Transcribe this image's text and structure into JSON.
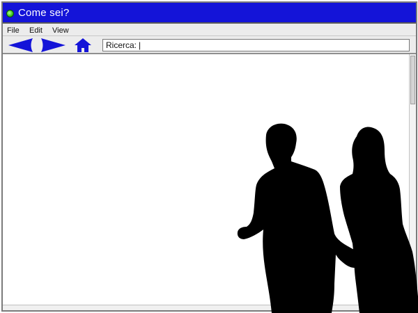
{
  "window": {
    "title": "Come sei?"
  },
  "menu": {
    "items": [
      "File",
      "Edit",
      "View"
    ]
  },
  "toolbar": {
    "back_icon": "left-arrow-icon",
    "forward_icon": "right-arrow-icon",
    "home_icon": "house-icon",
    "icon_color": "#1414d8"
  },
  "search": {
    "label": "Ricerca:",
    "value": ""
  },
  "colors": {
    "titlebar": "#1414d8",
    "chrome": "#ececec",
    "status_dot": "#36c41a",
    "silhouette": "#000000"
  }
}
